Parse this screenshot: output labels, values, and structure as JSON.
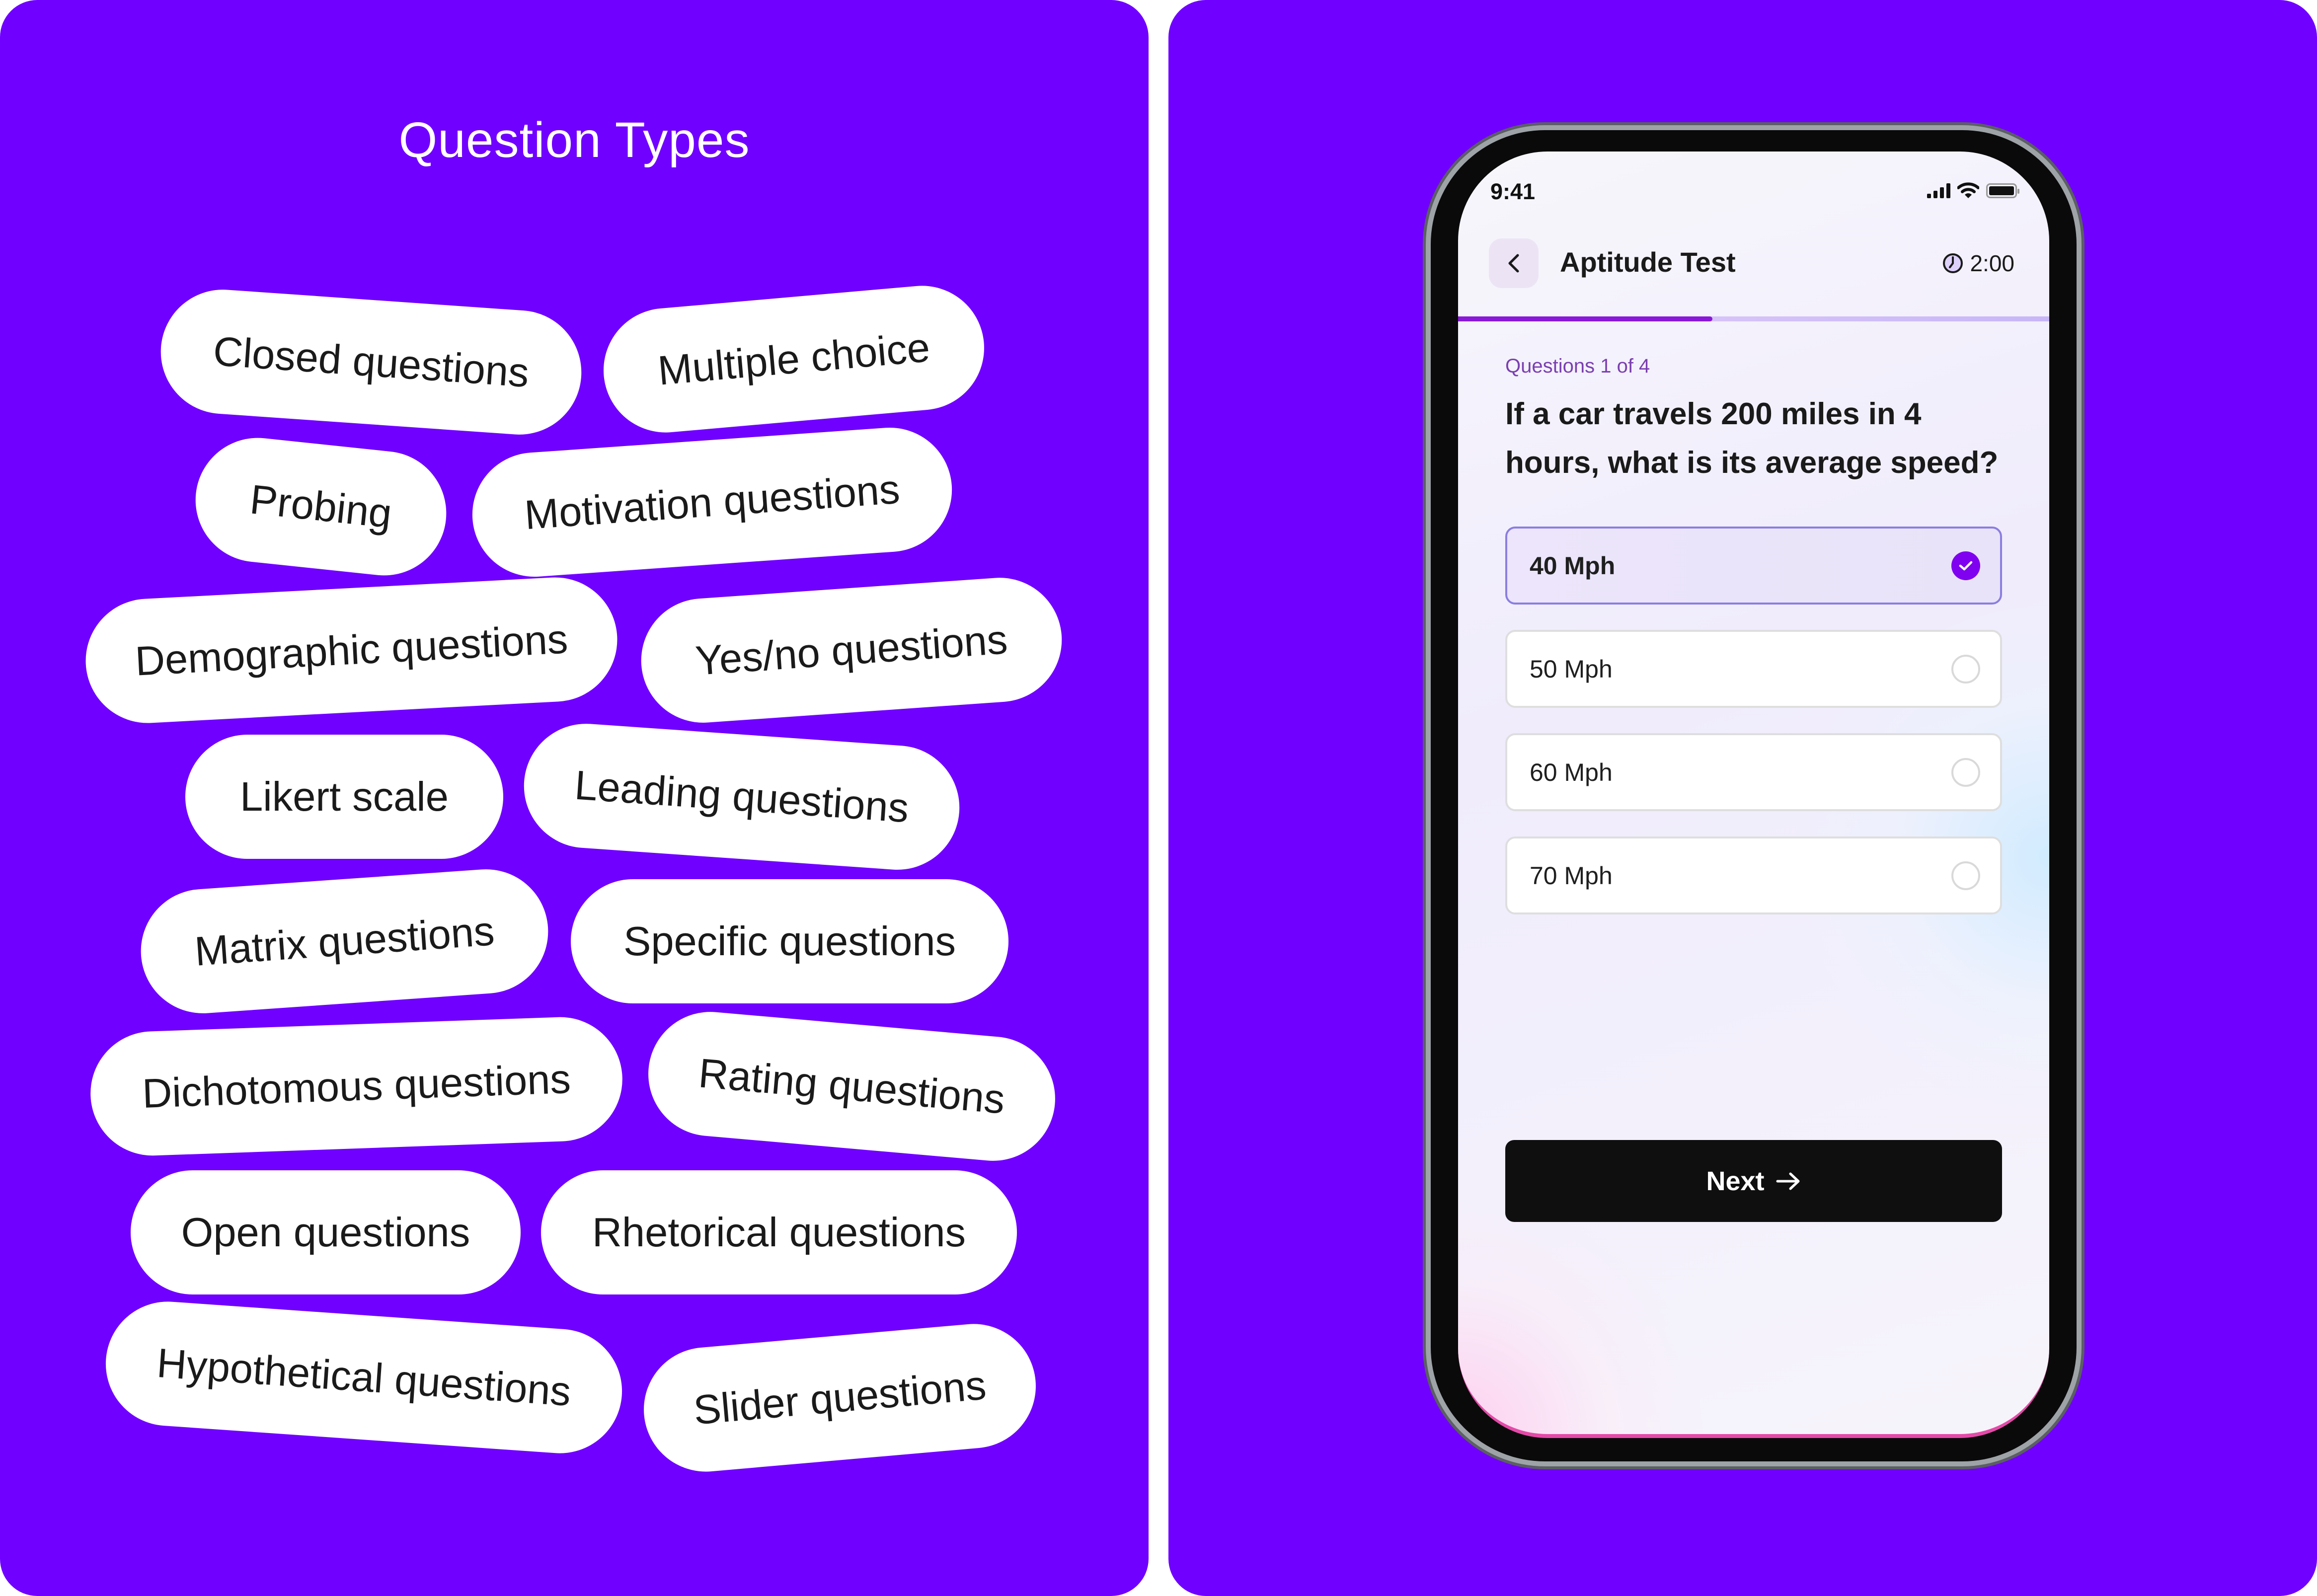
{
  "left_panel": {
    "heading": "Question Types",
    "pills": [
      {
        "label": "Closed questions"
      },
      {
        "label": "Multiple choice"
      },
      {
        "label": "Probing"
      },
      {
        "label": "Motivation questions"
      },
      {
        "label": "Demographic questions"
      },
      {
        "label": "Yes/no questions"
      },
      {
        "label": "Likert scale"
      },
      {
        "label": "Leading questions"
      },
      {
        "label": "Matrix questions"
      },
      {
        "label": "Specific questions"
      },
      {
        "label": "Dichotomous questions"
      },
      {
        "label": "Rating questions"
      },
      {
        "label": "Open questions"
      },
      {
        "label": "Rhetorical questions"
      },
      {
        "label": "Hypothetical questions"
      },
      {
        "label": "Slider questions"
      }
    ]
  },
  "phone": {
    "status_bar": {
      "time": "9:41",
      "icons": [
        "signal-icon",
        "wifi-icon",
        "battery-icon"
      ]
    },
    "header": {
      "back_icon": "chevron-left-icon",
      "title": "Aptitude Test",
      "timer_icon": "clock-icon",
      "timer": "2:00"
    },
    "progress": {
      "current": 1,
      "total": 4,
      "fraction": 0.43
    },
    "question_counter": "Questions 1 of 4",
    "question": "If a car travels 200 miles in 4 hours, what is its average speed?",
    "options": [
      {
        "label": "40 Mph",
        "selected": true
      },
      {
        "label": "50 Mph",
        "selected": false
      },
      {
        "label": "60 Mph",
        "selected": false
      },
      {
        "label": "70 Mph",
        "selected": false
      }
    ],
    "next_button": {
      "label": "Next",
      "icon": "arrow-right-icon"
    }
  },
  "colors": {
    "brand": "#7000ff",
    "progress": "#8a18d8",
    "accent_check": "#8000f0",
    "counter": "#7b3fb0",
    "button": "#0f0f10"
  }
}
